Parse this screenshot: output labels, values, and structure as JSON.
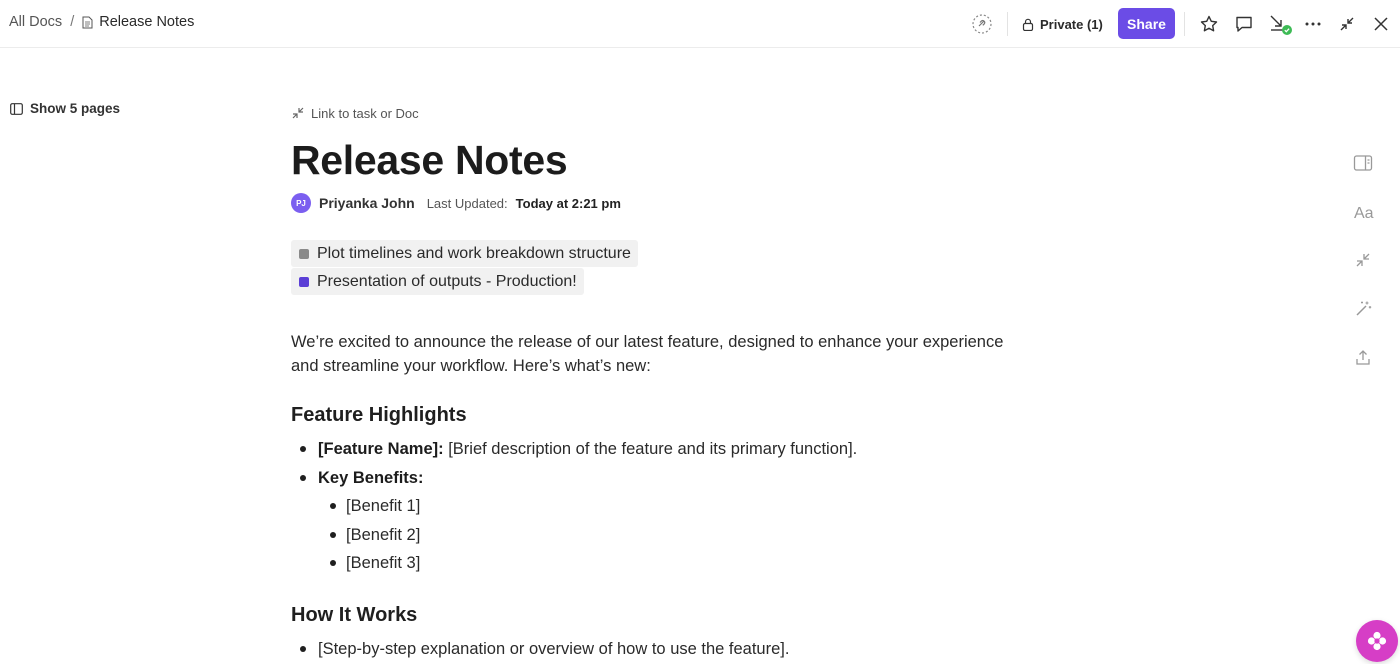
{
  "breadcrumb": {
    "root": "All Docs",
    "separator": "/",
    "current": "Release Notes"
  },
  "toolbar": {
    "privacy_label": "Private (1)",
    "share_label": "Share",
    "share_color": "#6b4ce6",
    "icons": [
      "tag-icon",
      "lock-icon",
      "star-icon",
      "comment-icon",
      "download-icon",
      "more-icon",
      "collapse-icon",
      "close-icon"
    ]
  },
  "sidebar": {
    "toggle_label": "Show 5 pages"
  },
  "document": {
    "link_label": "Link to task or Doc",
    "title": "Release Notes",
    "author": {
      "initials": "PJ",
      "name": "Priyanka John",
      "avatar_color": "#7b5ff0"
    },
    "last_updated_label": "Last Updated:",
    "last_updated_value": "Today at 2:21 pm",
    "relations": [
      {
        "label": "Plot timelines and work breakdown structure",
        "color": "#8a8a8a"
      },
      {
        "label": "Presentation of outputs - Production!",
        "color": "#5b3fd6"
      }
    ],
    "intro": "We’re excited to announce the release of our latest feature, designed to enhance your experience and streamline your workflow. Here’s what’s new:",
    "sections": {
      "highlights": {
        "heading": "Feature Highlights",
        "feature_name_label": "[Feature Name]:",
        "feature_name_desc": " [Brief description of the feature and its primary function].",
        "benefits_label": "Key Benefits:",
        "benefits": [
          "[Benefit 1]",
          "[Benefit 2]",
          "[Benefit 3]"
        ]
      },
      "how_it_works": {
        "heading": "How It Works",
        "items": [
          "[Step-by-step explanation or overview of how to use the feature]."
        ]
      }
    }
  },
  "right_rail": {
    "icons": [
      "panel-icon",
      "font-size-icon",
      "link-icon",
      "magic-wand-icon",
      "export-icon"
    ]
  },
  "fab": {
    "icon": "flower-icon",
    "color": "#d63ec6"
  }
}
